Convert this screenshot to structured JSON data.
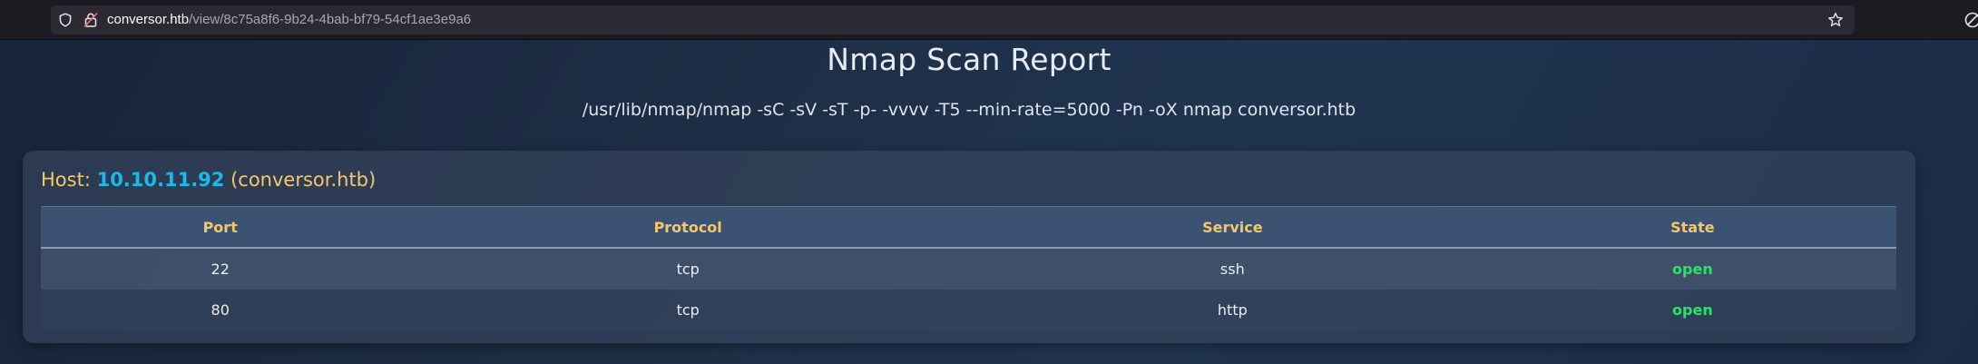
{
  "browser": {
    "url_host": "conversor.htb",
    "url_path": "/view/8c75a8f6-9b24-4bab-bf79-54cf1ae3e9a6"
  },
  "report": {
    "title": "Nmap Scan Report",
    "command": "/usr/lib/nmap/nmap -sC -sV -sT -p- -vvvv -T5 --min-rate=5000 -Pn -oX nmap conversor.htb",
    "host": {
      "label": "Host:",
      "ip": "10.10.11.92",
      "hostname": "(conversor.htb)"
    },
    "table": {
      "headers": [
        "Port",
        "Protocol",
        "Service",
        "State"
      ],
      "rows": [
        [
          "22",
          "tcp",
          "ssh",
          "open"
        ],
        [
          "80",
          "tcp",
          "http",
          "open"
        ]
      ]
    }
  },
  "colors": {
    "accent": "#f5c76b",
    "ip": "#19b9e8",
    "open_state": "#2ee06a"
  },
  "icons": [
    "shield-icon",
    "lock-icon",
    "bookmark-star-icon",
    "extension-icon"
  ]
}
